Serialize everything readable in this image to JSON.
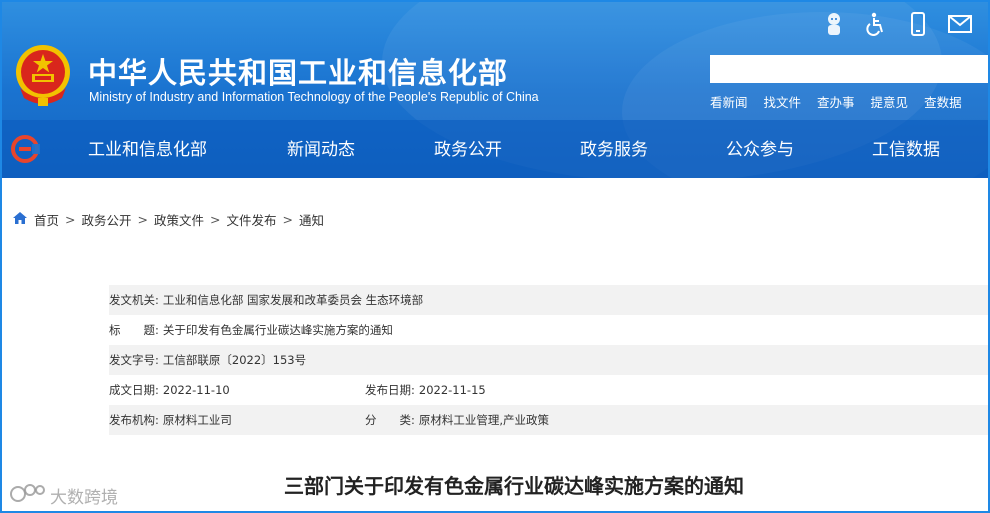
{
  "header": {
    "title_cn": "中华人民共和国工业和信息化部",
    "title_en": "Ministry of Industry and Information Technology of the People's Republic of China",
    "icons": [
      "elder-mode-icon",
      "accessibility-icon",
      "mobile-icon",
      "mail-icon"
    ],
    "search": {
      "value": "",
      "placeholder": ""
    },
    "quick_links": [
      "看新闻",
      "找文件",
      "查办事",
      "提意见",
      "查数据"
    ],
    "brand_color": "#1a73d0"
  },
  "nav": {
    "items": [
      "工业和信息化部",
      "新闻动态",
      "政务公开",
      "政务服务",
      "公众参与",
      "工信数据"
    ]
  },
  "breadcrumb": [
    "首页",
    "政务公开",
    "政策文件",
    "文件发布",
    "通知"
  ],
  "meta": {
    "issuer_label": "发文机关:",
    "issuer_value": "工业和信息化部 国家发展和改革委员会 生态环境部",
    "title_label": "标　　题:",
    "title_value": "关于印发有色金属行业碳达峰实施方案的通知",
    "docno_label": "发文字号:",
    "docno_value": "工信部联原〔2022〕153号",
    "created_label": "成文日期:",
    "created_value": "2022-11-10",
    "published_label": "发布日期:",
    "published_value": "2022-11-15",
    "org_label": "发布机构:",
    "org_value": "原材料工业司",
    "category_label": "分　　类:",
    "category_value": "原材料工业管理,产业政策"
  },
  "doc_title": "三部门关于印发有色金属行业碳达峰实施方案的通知",
  "watermark": "大数跨境"
}
